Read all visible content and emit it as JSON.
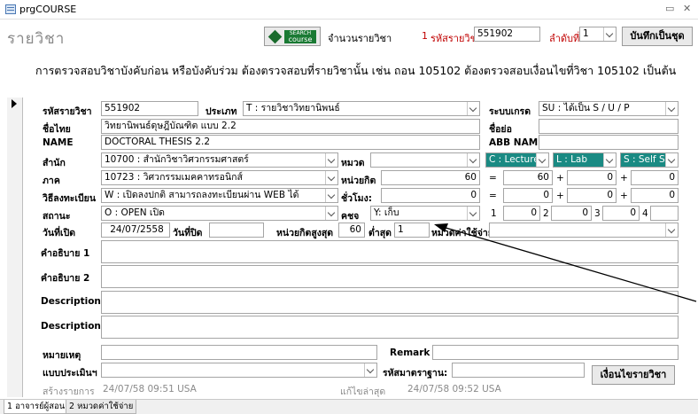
{
  "window": {
    "title": "prgCOURSE",
    "minimize": "▭",
    "close": "✕"
  },
  "header": {
    "page_title": "รายวิชา",
    "search_button": {
      "line1": "SEARCH",
      "line2": "course"
    },
    "count_label": "จำนวนรายวิชา",
    "count_value": "1",
    "course_code_label": "รหัสรายวิชา",
    "course_code_value": "551902",
    "seq_label": "ลำดับที่",
    "seq_value": "1",
    "save_button": "บันทึกเป็นชุด",
    "notice": "การตรวจสอบวิชาบังคับก่อน หรือบังคับร่วม ต้องตรวจสอบที่รายวิชานั้น เช่น ถอน 105102 ต้องตรวจสอบเงื่อนไขที่วิชา 105102 เป็นต้น"
  },
  "form": {
    "course_code": {
      "label": "รหัสรายวิชา",
      "value": "551902"
    },
    "type": {
      "label": "ประเภท",
      "value": "T : รายวิชาวิทยานิพนธ์"
    },
    "grading": {
      "label": "ระบบเกรด",
      "value": "SU : ได้เป็น S / U / P"
    },
    "thai_name": {
      "label": "ชื่อไทย",
      "value": "วิทยานิพนธ์ดุษฎีบัณฑิต  แบบ 2.2"
    },
    "short_name": {
      "label": "ชื่อย่อ",
      "value": ""
    },
    "name": {
      "label": "NAME",
      "value": "DOCTORAL THESIS 2.2"
    },
    "abb_name": {
      "label": "ABB NAME",
      "value": ""
    },
    "office": {
      "label": "สำนัก",
      "value": "10700 : สำนักวิชาวิศวกรรมศาสตร์"
    },
    "category": {
      "label": "หมวด",
      "value": ""
    },
    "type_lecture": "C : Lecture",
    "type_lab": "L : Lab",
    "type_self": "S : Self S",
    "department": {
      "label": "ภาค",
      "value": "10723 : วิศวกรรมเมคคาทรอนิกส์"
    },
    "credit": {
      "label": "หน่วยกิต",
      "value": "60"
    },
    "credit_eq": "=",
    "credit_lecture": "60",
    "credit_plus1": "+",
    "credit_lab": "0",
    "credit_plus2": "+",
    "credit_self": "0",
    "registration": {
      "label": "วิธีลงทะเบียน",
      "value": "W : เปิดลงปกติ สามารถลงทะเบียนผ่าน WEB ได้"
    },
    "hours": {
      "label": "ชั่วโมง:",
      "value": "0"
    },
    "hours_eq": "=",
    "hours_lecture": "0",
    "hours_plus1": "+",
    "hours_lab": "0",
    "hours_plus2": "+",
    "hours_self": "0",
    "status": {
      "label": "สถานะ",
      "value": "O : OPEN เปิด"
    },
    "fee": {
      "label": "คชจ",
      "value": "Y: เก็บ"
    },
    "slot1_label": "1",
    "slot1_value": "0",
    "slot2_label": "2",
    "slot2_value": "0",
    "slot3_label": "3",
    "slot3_value": "0",
    "slot4_label": "4",
    "slot4_value": "",
    "open_date": {
      "label": "วันที่เปิด",
      "value": "24/07/2558"
    },
    "close_date": {
      "label": "วันที่ปิด",
      "value": ""
    },
    "max_credit": {
      "label": "หน่วยกิตสูงสุด",
      "value": "60"
    },
    "min_credit": {
      "label": "ต่ำสุด",
      "value": "1"
    },
    "expense_category": {
      "label": "หมวดค่าใช้จ่าย",
      "value": ""
    },
    "desc1": {
      "label": "คำอธิบาย 1"
    },
    "desc2": {
      "label": "คำอธิบาย 2"
    },
    "description1": {
      "label": "Description 1"
    },
    "description2": {
      "label": "Description 2"
    },
    "note": {
      "label": "หมายเหตุ"
    },
    "remark": {
      "label": "Remark"
    },
    "assessment": {
      "label": "แบบประเมินฯ",
      "value": ""
    },
    "standard_code": {
      "label": "รหัสมาตราฐาน:",
      "value": ""
    },
    "verify_button": "เงื่อนไขรายวิชา",
    "created_label": "สร้างรายการ",
    "created_value": "24/07/58 09:51 USA",
    "modified_label": "แก้ไขล่าสุด",
    "modified_value": "24/07/58 09:52 USA"
  },
  "tabs": [
    {
      "label": "1 อาจารย์ผู้สอน"
    },
    {
      "label": "2 หมวดค่าใช้จ่าย"
    }
  ],
  "colors": {
    "accent_teal": "#1a8a83",
    "highlight_red": "#c00000",
    "search_green": "#1a7a34"
  }
}
